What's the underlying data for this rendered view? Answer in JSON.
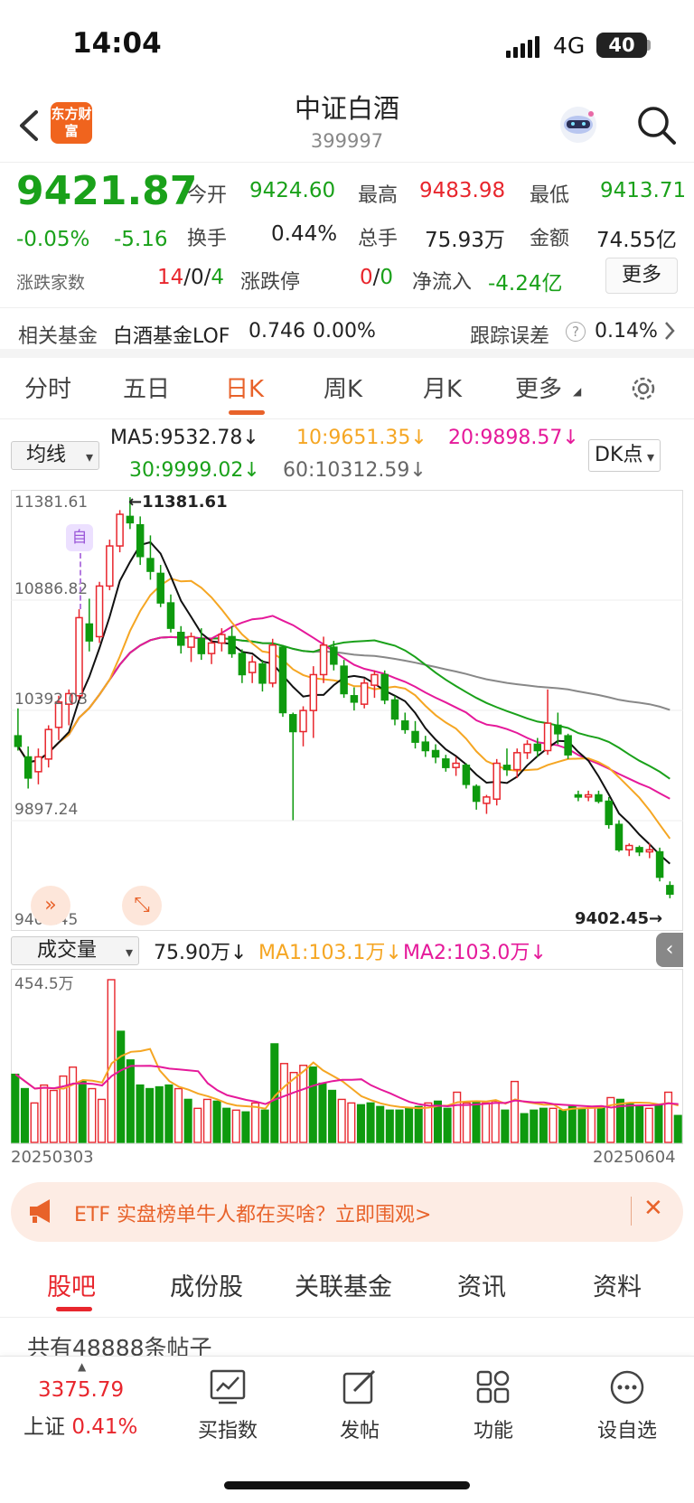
{
  "status": {
    "time": "14:04",
    "network": "4G",
    "battery": "40"
  },
  "nav": {
    "logo_text": "东方财富",
    "title": "中证白酒",
    "code": "399997"
  },
  "quote": {
    "price": "9421.87",
    "pct": "-0.05%",
    "chg": "-5.16",
    "open_label": "今开",
    "open": "9424.60",
    "high_label": "最高",
    "high": "9483.98",
    "low_label": "最低",
    "low": "9413.71",
    "turnover_label": "换手",
    "turnover": "0.44%",
    "vol_label": "总手",
    "vol": "75.93万",
    "amount_label": "金额",
    "amount": "74.55亿",
    "updown_label": "涨跌家数",
    "up": "14",
    "sep1": "/",
    "flat": "0",
    "sep2": "/",
    "down": "4",
    "limit_label": "涨跌停",
    "limit_up": "0",
    "limit_sep": "/",
    "limit_down": "0",
    "inflow_label": "净流入",
    "inflow": "-4.24亿",
    "more": "更多"
  },
  "fund": {
    "label": "相关基金",
    "name": "白酒基金LOF",
    "price": "0.746",
    "pct": "0.00%",
    "err_label": "跟踪误差",
    "err": "0.14%"
  },
  "tabs": [
    "分时",
    "五日",
    "日K",
    "周K",
    "月K",
    "更多"
  ],
  "ma": {
    "select": "均线",
    "ma5": "MA5:9532.78",
    "ma10": "10:9651.35",
    "ma20": "20:9898.57",
    "ma30": "30:9999.02",
    "ma60": "60:10312.59",
    "dk": "DK点",
    "arrow": "↓"
  },
  "chart_labels": {
    "p1": "11381.61",
    "p2": "10886.82",
    "p3": "10392.03",
    "p4": "9897.24",
    "p5": "9402.45",
    "hi_mark": "11381.61",
    "lo_mark": "9402.45",
    "marker": "自"
  },
  "volume": {
    "select": "成交量",
    "value": "75.90万",
    "ma1": "MA1:103.1万",
    "ma2": "MA2:103.0万",
    "top": "454.5万",
    "start": "20250303",
    "end": "20250604"
  },
  "chart_data": {
    "type": "candlestick",
    "ylim": [
      9402.45,
      11381.61
    ],
    "ohlc": [
      [
        10250,
        10380,
        10180,
        10200
      ],
      [
        10150,
        10200,
        10000,
        10050
      ],
      [
        10080,
        10190,
        10020,
        10150
      ],
      [
        10140,
        10300,
        10100,
        10280
      ],
      [
        10290,
        10440,
        10230,
        10410
      ],
      [
        10400,
        10470,
        10300,
        10450
      ],
      [
        10440,
        10850,
        10420,
        10810
      ],
      [
        10780,
        10900,
        10650,
        10700
      ],
      [
        10720,
        10980,
        10690,
        10960
      ],
      [
        10960,
        11180,
        10940,
        11150
      ],
      [
        11150,
        11320,
        11120,
        11300
      ],
      [
        11290,
        11381,
        11230,
        11260
      ],
      [
        11250,
        11290,
        11060,
        11100
      ],
      [
        11090,
        11200,
        10990,
        11030
      ],
      [
        11020,
        11060,
        10860,
        10880
      ],
      [
        10880,
        10920,
        10740,
        10760
      ],
      [
        10740,
        10770,
        10640,
        10680
      ],
      [
        10670,
        10740,
        10600,
        10720
      ],
      [
        10710,
        10760,
        10610,
        10640
      ],
      [
        10640,
        10710,
        10590,
        10690
      ],
      [
        10690,
        10760,
        10650,
        10730
      ],
      [
        10720,
        10770,
        10620,
        10640
      ],
      [
        10640,
        10660,
        10500,
        10540
      ],
      [
        10550,
        10630,
        10500,
        10600
      ],
      [
        10590,
        10610,
        10460,
        10500
      ],
      [
        10500,
        10710,
        10480,
        10680
      ],
      [
        10670,
        10680,
        10340,
        10360
      ],
      [
        10350,
        10360,
        9850,
        10270
      ],
      [
        10270,
        10390,
        10200,
        10370
      ],
      [
        10370,
        10580,
        10240,
        10540
      ],
      [
        10540,
        10720,
        10500,
        10680
      ],
      [
        10670,
        10700,
        10560,
        10590
      ],
      [
        10580,
        10610,
        10430,
        10450
      ],
      [
        10440,
        10480,
        10370,
        10410
      ],
      [
        10400,
        10520,
        10380,
        10500
      ],
      [
        10490,
        10560,
        10430,
        10540
      ],
      [
        10540,
        10560,
        10400,
        10420
      ],
      [
        10420,
        10440,
        10300,
        10330
      ],
      [
        10320,
        10360,
        10260,
        10280
      ],
      [
        10270,
        10320,
        10190,
        10220
      ],
      [
        10220,
        10250,
        10150,
        10180
      ],
      [
        10180,
        10210,
        10120,
        10150
      ],
      [
        10140,
        10160,
        10080,
        10100
      ],
      [
        10100,
        10150,
        10060,
        10120
      ],
      [
        10110,
        10120,
        10000,
        10020
      ],
      [
        10010,
        10020,
        9900,
        9940
      ],
      [
        9930,
        9970,
        9880,
        9960
      ],
      [
        9950,
        10140,
        9920,
        10120
      ],
      [
        10110,
        10190,
        10060,
        10090
      ],
      [
        10090,
        10190,
        10050,
        10170
      ],
      [
        10170,
        10230,
        10140,
        10210
      ],
      [
        10210,
        10240,
        10150,
        10180
      ],
      [
        10180,
        10470,
        10160,
        10310
      ],
      [
        10300,
        10360,
        10210,
        10260
      ],
      [
        10250,
        10260,
        10140,
        10160
      ],
      [
        9970,
        9990,
        9940,
        9960
      ],
      [
        9960,
        9990,
        9940,
        9970
      ],
      [
        9970,
        9990,
        9930,
        9940
      ],
      [
        9940,
        9960,
        9810,
        9830
      ],
      [
        9830,
        9850,
        9700,
        9710
      ],
      [
        9710,
        9740,
        9680,
        9730
      ],
      [
        9720,
        9730,
        9680,
        9700
      ],
      [
        9700,
        9740,
        9670,
        9710
      ],
      [
        9700,
        9720,
        9560,
        9580
      ],
      [
        9540,
        9560,
        9480,
        9500
      ]
    ],
    "volume": [
      190,
      150,
      110,
      160,
      145,
      185,
      210,
      170,
      150,
      120,
      454,
      310,
      230,
      160,
      150,
      155,
      160,
      150,
      120,
      95,
      120,
      115,
      95,
      90,
      85,
      110,
      90,
      275,
      220,
      195,
      215,
      210,
      165,
      145,
      120,
      110,
      105,
      110,
      100,
      90,
      90,
      95,
      100,
      110,
      115,
      95,
      140,
      110,
      115,
      110,
      115,
      90,
      170,
      80,
      90,
      95,
      95,
      90,
      100,
      95,
      100,
      100,
      125,
      120,
      110,
      100,
      95,
      105,
      140,
      75
    ]
  }
}
